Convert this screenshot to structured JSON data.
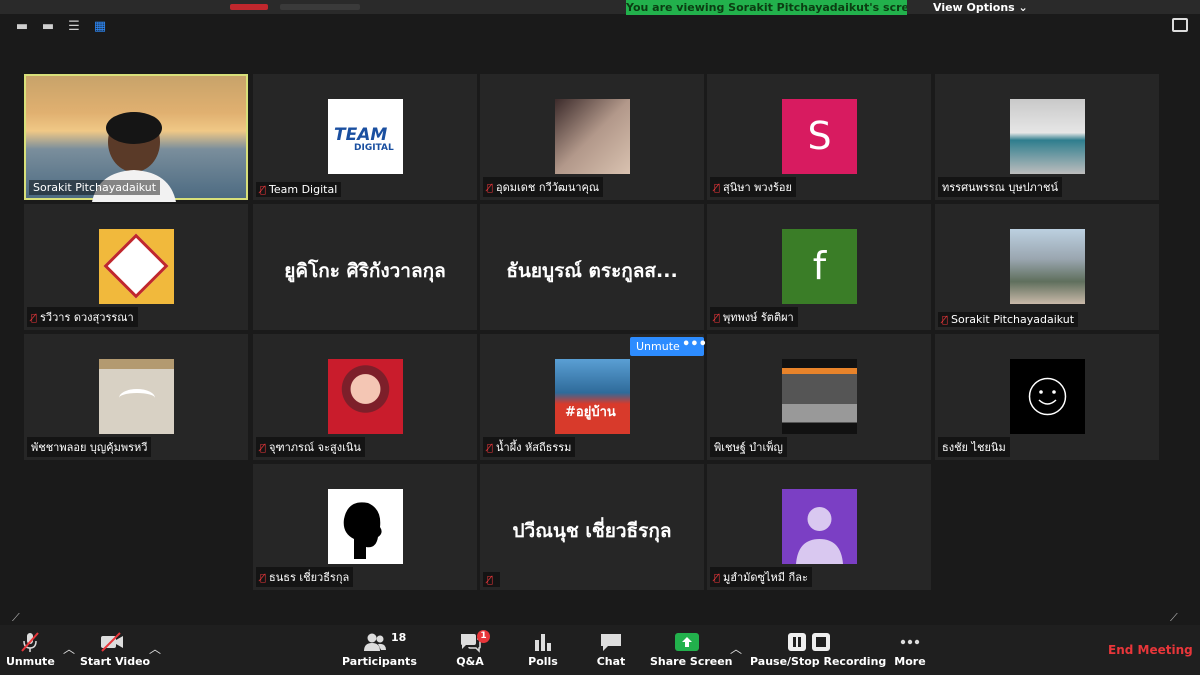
{
  "top": {
    "banner": "You are viewing Sorakit Pitchayadaikut's screen",
    "view_options": "View Options ⌄"
  },
  "tiles": [
    {
      "name": "Sorakit Pitchayadaikut"
    },
    {
      "name": "Team Digital",
      "logo_line1": "TEAM",
      "logo_line2": "DIGITAL"
    },
    {
      "name": "อุดมเดช กวีวัฒนาคุณ"
    },
    {
      "name": "สุนิษา พวงร้อย",
      "letter": "S"
    },
    {
      "name": "ทรรศนพรรณ บุษปภาชน์"
    },
    {
      "name": "รวีวาร ดวงสุวรรณา"
    },
    {
      "big": "ยูคิโกะ  ศิริกังวาลกุล"
    },
    {
      "big": "ธันยบูรณ์ ตระกูลส..."
    },
    {
      "name": "พุทพงษ์ รัตติผา",
      "letter": "f"
    },
    {
      "name": "Sorakit Pitchayadaikut"
    },
    {
      "name": "พัชชาพลอย บุญคุ้มพรหวี"
    },
    {
      "name": "จุฑาภรณ์  จะสูงเนิน"
    },
    {
      "name": "น้ำผึ้ง หัสถีธรรม",
      "thumb_text": "#อยู่บ้าน"
    },
    {
      "name": "พิเชษฐ์ บำเพ็ญ"
    },
    {
      "name": "ธงชัย ไชยนิม"
    },
    {
      "name": "ธนธร เชี่ยวธีรกุล"
    },
    {
      "big": "ปวีณนุช เชี่ยวธีรกุล"
    },
    {
      "name": "มูฮำมัดซูไหมี กีละ"
    }
  ],
  "popover": {
    "unmute": "Unmute",
    "more": "•••"
  },
  "toolbar": {
    "unmute": "Unmute",
    "start_video": "Start Video",
    "participants": "Participants",
    "participants_count": "18",
    "qa": "Q&A",
    "qa_badge": "1",
    "polls": "Polls",
    "chat": "Chat",
    "share_screen": "Share Screen",
    "record": "Pause/Stop Recording",
    "more": "More",
    "end_meeting": "End Meeting"
  },
  "colors": {
    "accent_blue": "#2d8cff",
    "banner_green": "#22b14c",
    "mute_red": "#e8363a",
    "s_avatar": "#d81b60",
    "f_avatar": "#3a7d27",
    "default_avatar": "#7b3fc4"
  }
}
